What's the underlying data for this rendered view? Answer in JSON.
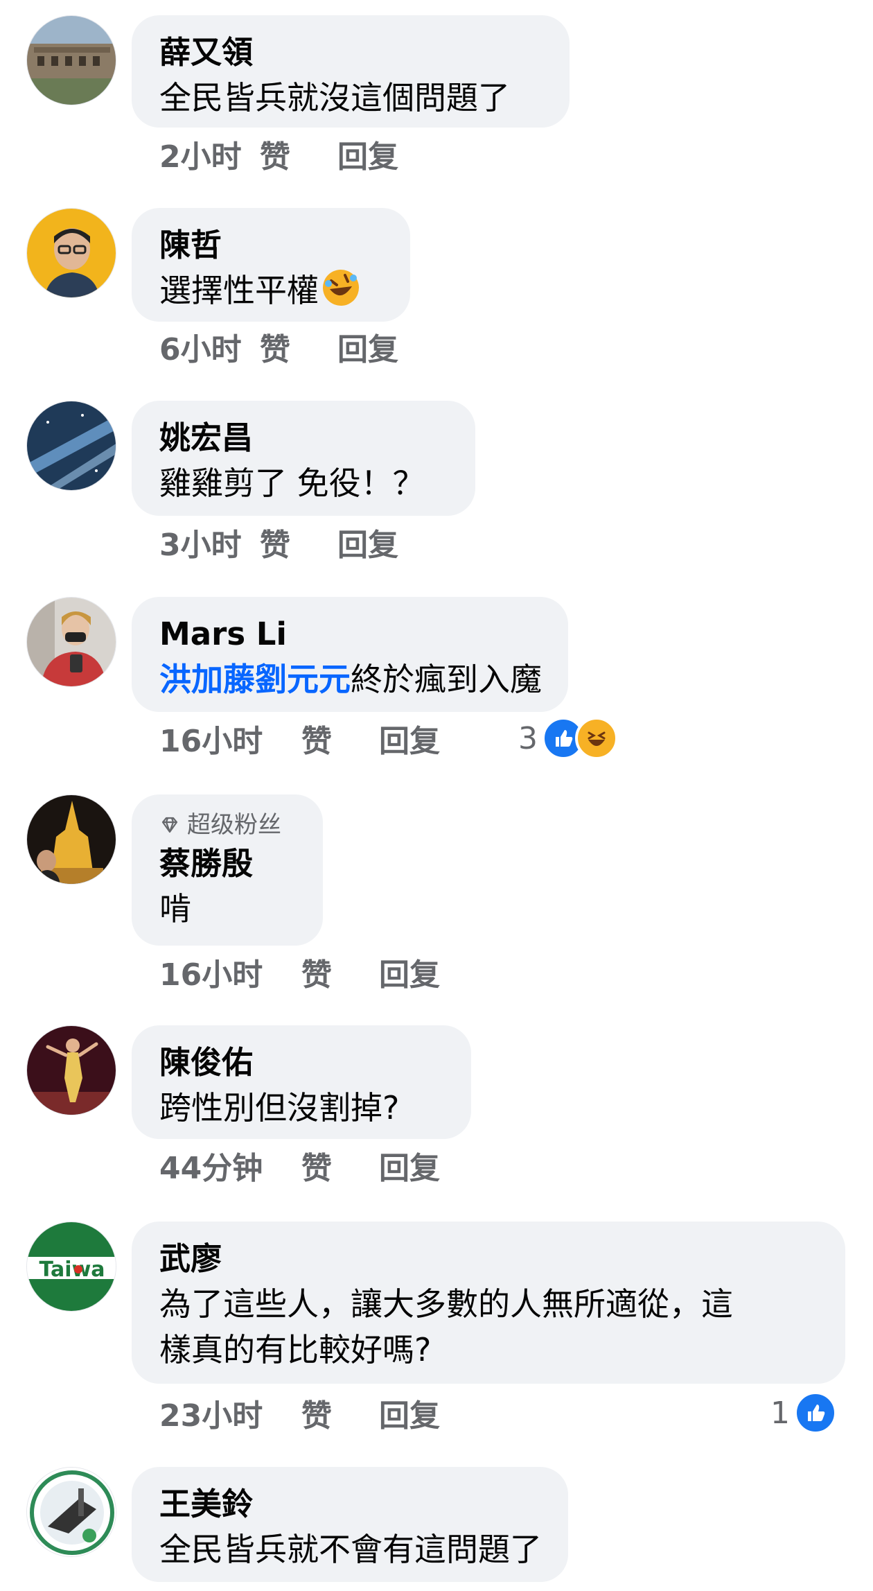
{
  "comments": [
    {
      "name": "薛又領",
      "text": "全民皆兵就沒這個問題了",
      "time": "2小时",
      "like": "赞",
      "reply": "回复"
    },
    {
      "name": "陳哲",
      "text": "選擇性平權",
      "emoji": "rolling-on-floor-laughing-emoji",
      "time": "6小时",
      "like": "赞",
      "reply": "回复"
    },
    {
      "name": "姚宏昌",
      "text": "雞雞剪了 免役！？",
      "time": "3小时",
      "like": "赞",
      "reply": "回复"
    },
    {
      "name": "Mars Li",
      "mention": "洪加藤劉元元",
      "text": "終於瘋到入魔",
      "time": "16小时",
      "like": "赞",
      "reply": "回复",
      "reaction_count": "3",
      "reactions": [
        "like",
        "haha"
      ]
    },
    {
      "badge": "超级粉丝",
      "name": "蔡勝殷",
      "text": "啃",
      "time": "16小时",
      "like": "赞",
      "reply": "回复"
    },
    {
      "name": "陳俊佑",
      "text": "跨性別但沒割掉?",
      "time": "44分钟",
      "like": "赞",
      "reply": "回复"
    },
    {
      "name": "武廖",
      "text_lines": [
        "為了這些人，讓大多數的人無所適從，這",
        "樣真的有比較好嗎?"
      ],
      "time": "23小时",
      "like": "赞",
      "reply": "回复",
      "reaction_count": "1",
      "reactions": [
        "like"
      ]
    },
    {
      "name": "王美鈴",
      "text": "全民皆兵就不會有這問題了"
    }
  ],
  "avatar_text": {
    "taiwan_logo": "Taiwa"
  },
  "colors": {
    "bubble": "#f0f2f5",
    "meta": "#65676b",
    "mention": "#0866ff",
    "like_blue": "#1877f2",
    "haha_yellow": "#f7b125"
  }
}
